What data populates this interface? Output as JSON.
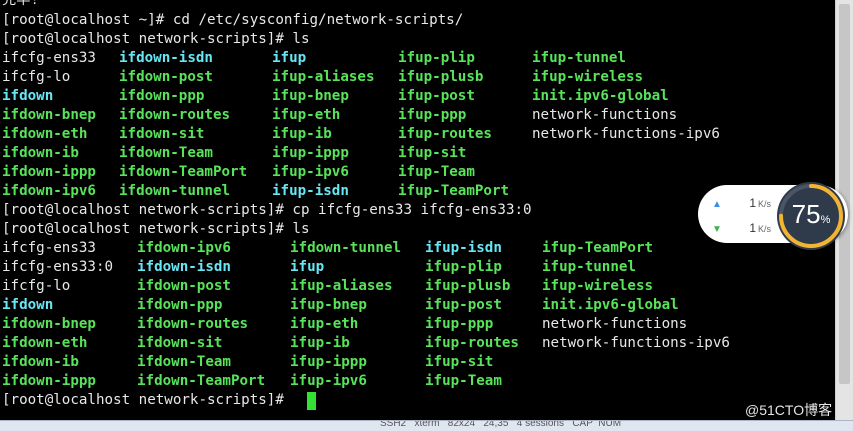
{
  "terminal": {
    "top_partial": "完毕!",
    "prompt1": "[root@localhost ~]# cd /etc/sysconfig/network-scripts/",
    "prompt2": "[root@localhost network-scripts]# ls",
    "listing1": [
      [
        [
          "ifcfg-ens33",
          "plain"
        ],
        [
          "ifdown-isdn",
          "link"
        ],
        [
          "ifup",
          "link"
        ],
        [
          "ifup-plip",
          "exec"
        ],
        [
          "ifup-tunnel",
          "exec"
        ]
      ],
      [
        [
          "ifcfg-lo",
          "plain"
        ],
        [
          "ifdown-post",
          "exec"
        ],
        [
          "ifup-aliases",
          "exec"
        ],
        [
          "ifup-plusb",
          "exec"
        ],
        [
          "ifup-wireless",
          "exec"
        ]
      ],
      [
        [
          "ifdown",
          "link"
        ],
        [
          "ifdown-ppp",
          "exec"
        ],
        [
          "ifup-bnep",
          "exec"
        ],
        [
          "ifup-post",
          "exec"
        ],
        [
          "init.ipv6-global",
          "exec"
        ]
      ],
      [
        [
          "ifdown-bnep",
          "exec"
        ],
        [
          "ifdown-routes",
          "exec"
        ],
        [
          "ifup-eth",
          "exec"
        ],
        [
          "ifup-ppp",
          "exec"
        ],
        [
          "network-functions",
          "plain"
        ]
      ],
      [
        [
          "ifdown-eth",
          "exec"
        ],
        [
          "ifdown-sit",
          "exec"
        ],
        [
          "ifup-ib",
          "exec"
        ],
        [
          "ifup-routes",
          "exec"
        ],
        [
          "network-functions-ipv6",
          "plain"
        ]
      ],
      [
        [
          "ifdown-ib",
          "exec"
        ],
        [
          "ifdown-Team",
          "exec"
        ],
        [
          "ifup-ippp",
          "exec"
        ],
        [
          "ifup-sit",
          "exec"
        ],
        [
          "",
          ""
        ]
      ],
      [
        [
          "ifdown-ippp",
          "exec"
        ],
        [
          "ifdown-TeamPort",
          "exec"
        ],
        [
          "ifup-ipv6",
          "exec"
        ],
        [
          "ifup-Team",
          "exec"
        ],
        [
          "",
          ""
        ]
      ],
      [
        [
          "ifdown-ipv6",
          "exec"
        ],
        [
          "ifdown-tunnel",
          "exec"
        ],
        [
          "ifup-isdn",
          "link"
        ],
        [
          "ifup-TeamPort",
          "exec"
        ],
        [
          "",
          ""
        ]
      ]
    ],
    "prompt3": "[root@localhost network-scripts]# cp ifcfg-ens33 ifcfg-ens33:0",
    "prompt4": "[root@localhost network-scripts]# ls",
    "listing2": [
      [
        [
          "ifcfg-ens33",
          "plain"
        ],
        [
          "ifdown-ipv6",
          "exec"
        ],
        [
          "ifdown-tunnel",
          "exec"
        ],
        [
          "ifup-isdn",
          "link"
        ],
        [
          "ifup-TeamPort",
          "exec"
        ]
      ],
      [
        [
          "ifcfg-ens33:0",
          "plain"
        ],
        [
          "ifdown-isdn",
          "link"
        ],
        [
          "ifup",
          "link"
        ],
        [
          "ifup-plip",
          "exec"
        ],
        [
          "ifup-tunnel",
          "exec"
        ]
      ],
      [
        [
          "ifcfg-lo",
          "plain"
        ],
        [
          "ifdown-post",
          "exec"
        ],
        [
          "ifup-aliases",
          "exec"
        ],
        [
          "ifup-plusb",
          "exec"
        ],
        [
          "ifup-wireless",
          "exec"
        ]
      ],
      [
        [
          "ifdown",
          "link"
        ],
        [
          "ifdown-ppp",
          "exec"
        ],
        [
          "ifup-bnep",
          "exec"
        ],
        [
          "ifup-post",
          "exec"
        ],
        [
          "init.ipv6-global",
          "exec"
        ]
      ],
      [
        [
          "ifdown-bnep",
          "exec"
        ],
        [
          "ifdown-routes",
          "exec"
        ],
        [
          "ifup-eth",
          "exec"
        ],
        [
          "ifup-ppp",
          "exec"
        ],
        [
          "network-functions",
          "plain"
        ]
      ],
      [
        [
          "ifdown-eth",
          "exec"
        ],
        [
          "ifdown-sit",
          "exec"
        ],
        [
          "ifup-ib",
          "exec"
        ],
        [
          "ifup-routes",
          "exec"
        ],
        [
          "network-functions-ipv6",
          "plain"
        ]
      ],
      [
        [
          "ifdown-ib",
          "exec"
        ],
        [
          "ifdown-Team",
          "exec"
        ],
        [
          "ifup-ippp",
          "exec"
        ],
        [
          "ifup-sit",
          "exec"
        ],
        [
          "",
          ""
        ]
      ],
      [
        [
          "ifdown-ippp",
          "exec"
        ],
        [
          "ifdown-TeamPort",
          "exec"
        ],
        [
          "ifup-ipv6",
          "exec"
        ],
        [
          "ifup-Team",
          "exec"
        ],
        [
          "",
          ""
        ]
      ]
    ],
    "prompt5": "[root@localhost network-scripts]# "
  },
  "netmon": {
    "upload_value": "1",
    "upload_unit": "K/s",
    "download_value": "1",
    "download_unit": "K/s",
    "percent": "75",
    "percent_sign": "%",
    "gauge_fraction": 0.75
  },
  "status_bar": {
    "text": "SSH2   xterm   82x24   24,35   4 sessions   CAP  NUM"
  },
  "watermark": "@51CTO博客",
  "colors": {
    "background": "#000000",
    "plain": "#e8e8e8",
    "exec": "#58e35a",
    "link": "#67e6f4",
    "cursor": "#33e033"
  }
}
